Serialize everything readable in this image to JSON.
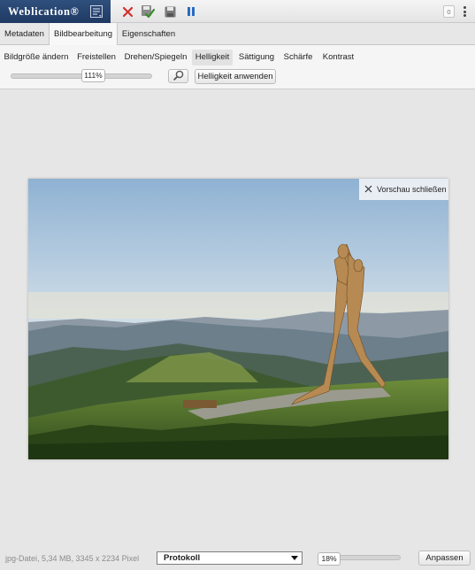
{
  "app": {
    "brand": "Weblication®"
  },
  "toolbar": {
    "icons": [
      "menu-icon",
      "close-icon",
      "save-check-icon",
      "save-icon",
      "pause-icon"
    ],
    "badge_count": "0"
  },
  "tabs": [
    {
      "label": "Metadaten"
    },
    {
      "label": "Bildbearbeitung",
      "active": true
    },
    {
      "label": "Eigenschaften"
    }
  ],
  "subtabs": [
    {
      "label": "Bildgröße ändern"
    },
    {
      "label": "Freistellen"
    },
    {
      "label": "Drehen/Spiegeln"
    },
    {
      "label": "Helligkeit",
      "active": true
    },
    {
      "label": "Sättigung"
    },
    {
      "label": "Schärfe"
    },
    {
      "label": "Kontrast"
    }
  ],
  "brightness": {
    "value_label": "111%",
    "apply_label": "Helligkeit anwenden"
  },
  "preview": {
    "close_label": "Vorschau schließen"
  },
  "status": {
    "file_info": "jpg-Datei, 5,34 MB, 3345 x 2234 Pixel",
    "log_select": "Protokoll",
    "zoom_label": "18%",
    "fit_label": "Anpassen"
  },
  "colors": {
    "brand_bg": "#1f3a63",
    "accent_red": "#d0312d",
    "accent_green": "#3a8a2e",
    "accent_blue": "#2a6bc4"
  }
}
